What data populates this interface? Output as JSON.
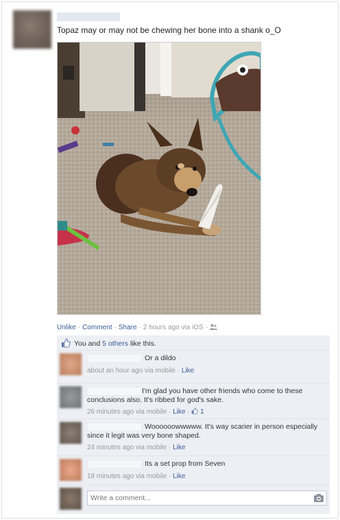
{
  "post": {
    "status_text": "Topaz may or may not be chewing her bone into a shank o_O",
    "actions": {
      "unlike": "Unlike",
      "comment": "Comment",
      "share": "Share",
      "timestamp": "2 hours ago via iOS",
      "audience_icon": "friends-icon"
    }
  },
  "likes": {
    "prefix": "You and ",
    "others_link": "5 others",
    "suffix": " like this.",
    "icon": "thumbs-up-icon"
  },
  "comments": [
    {
      "text": "Or a dildo",
      "meta": "about an hour ago via mobile",
      "like": "Like",
      "like_count": ""
    },
    {
      "text": "I'm glad you have other friends who come to these conclusions also. It's ribbed for god's sake.",
      "meta": "26 minutes ago via mobile",
      "like": "Like",
      "like_count": "1"
    },
    {
      "text": "Woooooowwwww. It's way scarier in person especially since it legit was very bone shaped.",
      "meta": "24 minutes ago via mobile",
      "like": "Like",
      "like_count": ""
    },
    {
      "text": "Its a set prop from Seven",
      "meta": "18 minutes ago via mobile",
      "like": "Like",
      "like_count": ""
    }
  ],
  "write_comment": {
    "placeholder": "Write a comment...",
    "icon": "camera-icon"
  },
  "colors": {
    "link": "#3b5998",
    "ufi_bg": "#edeff4",
    "meta": "#999999"
  }
}
